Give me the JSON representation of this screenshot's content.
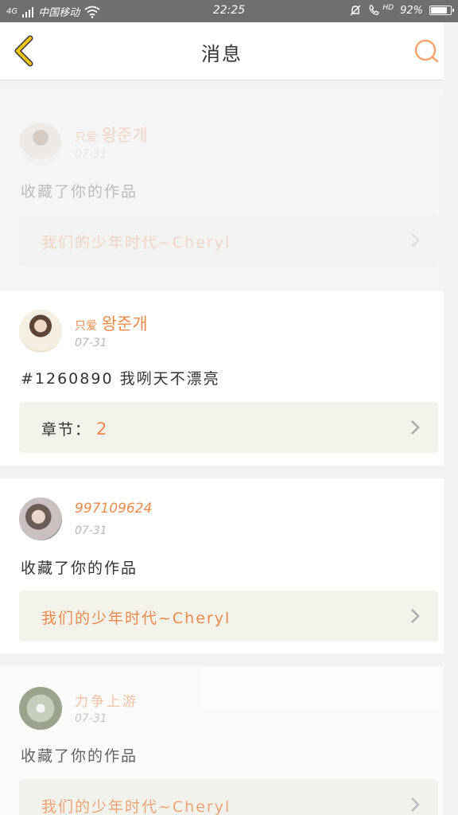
{
  "status_bar": {
    "carrier": "中国移动",
    "network": "4G",
    "time": "22:25",
    "battery": "92%",
    "hd_label": "HD",
    "battery_level": 0.92
  },
  "header": {
    "title": "消息"
  },
  "colors": {
    "accent": "#f08a4b",
    "status_bar": "#6f6f6f",
    "link_box": "#f3f3ec"
  },
  "messages": [
    {
      "username_prefix": "只爱",
      "username_main": "왕준개",
      "date": "07-31",
      "text": "收藏了你的作品",
      "link_text": "我们的少年时代~Cheryl"
    },
    {
      "username_prefix": "只爱",
      "username_main": "왕준개",
      "date": "07-31",
      "text": "#1260890 我咧天不漂亮",
      "link_label": "章节：",
      "link_number": "2"
    },
    {
      "username": "997109624",
      "date": "07-31",
      "text": "收藏了你的作品",
      "link_text": "我们的少年时代~Cheryl"
    },
    {
      "username": "力争上游",
      "date": "07-31",
      "text": "收藏了你的作品",
      "link_text": "我们的少年时代~Cheryl"
    }
  ]
}
